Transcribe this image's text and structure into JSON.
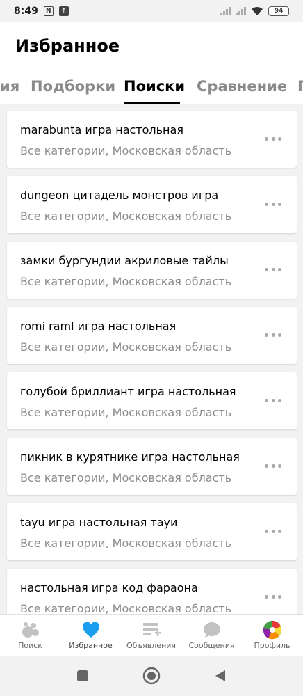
{
  "status_bar": {
    "time": "8:49",
    "n_icon": "N",
    "upload_icon": "↑",
    "battery": "94"
  },
  "header": {
    "title": "Избранное",
    "tabs": [
      {
        "label": "ия"
      },
      {
        "label": "Подборки"
      },
      {
        "label": "Поиски"
      },
      {
        "label": "Сравнение"
      },
      {
        "label": "П"
      }
    ]
  },
  "searches": [
    {
      "title": "marabunta игра настольная",
      "subtitle": "Все категории, Московская область"
    },
    {
      "title": "dungeon цитадель монстров игра",
      "subtitle": "Все категории, Московская область"
    },
    {
      "title": "замки бургундии акриловые тайлы",
      "subtitle": "Все категории, Московская область"
    },
    {
      "title": "romi raml игра настольная",
      "subtitle": "Все категории, Московская область"
    },
    {
      "title": "голубой бриллиант игра настольная",
      "subtitle": "Все категории, Московская область"
    },
    {
      "title": "пикник в курятнике игра настольная",
      "subtitle": "Все категории, Московская область"
    },
    {
      "title": "tayu игра настольная тауи",
      "subtitle": "Все категории, Московская область"
    },
    {
      "title": "настольная игра код фараона",
      "subtitle": "Все категории, Московская область"
    }
  ],
  "bottom_nav": [
    {
      "label": "Поиск",
      "icon": "search-dots-icon"
    },
    {
      "label": "Избранное",
      "icon": "heart-icon"
    },
    {
      "label": "Объявления",
      "icon": "listing-add-icon"
    },
    {
      "label": "Сообщения",
      "icon": "chat-bubble-icon"
    },
    {
      "label": "Профиль",
      "icon": "avatar-icon"
    }
  ],
  "colors": {
    "accent_blue": "#1a9ef0",
    "text_secondary": "#8c8c8c",
    "tab_inactive": "#8a8a8a"
  }
}
